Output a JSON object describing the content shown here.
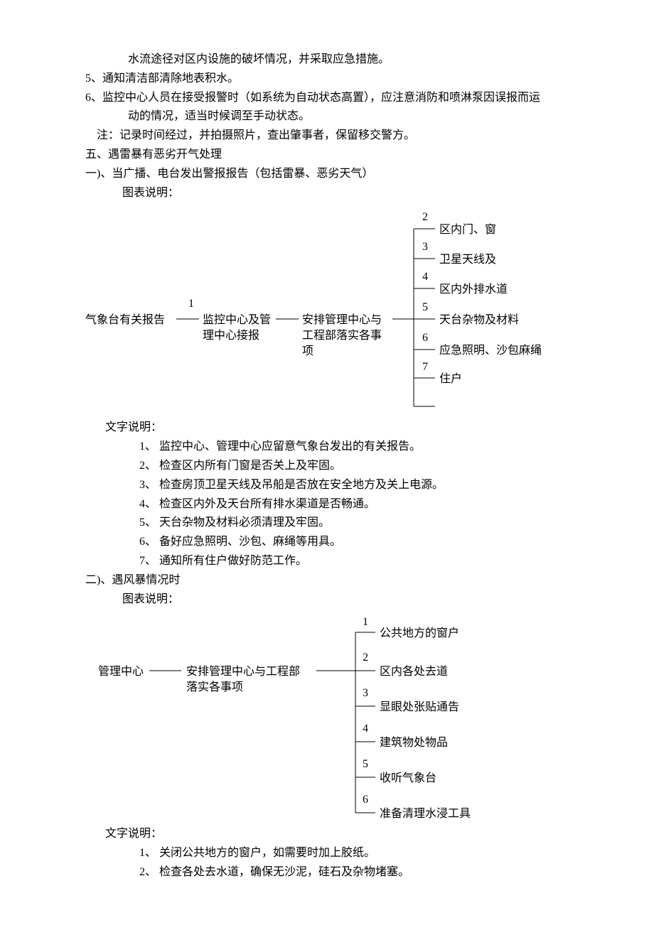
{
  "top": {
    "line0": "　　水流途径对区内设施的破坏情况，并采取应急措施。",
    "item5": "5、通知清洁部清除地表积水。",
    "item6a": "6、监控中心人员在接受报警时（如系统为自动状态高置），应注意消防和喷淋泵因误报而运",
    "item6b": "　　动的情况，适当时候调至手动状态。",
    "note": "　注：记录时间经过，并拍摄照片，查出肇事者，保留移交警方。"
  },
  "sec5": {
    "heading": "五、遇雷暴有恶劣开气处理",
    "sub1": "一)、当广播、电台发出警报报告（包括雷暴、恶劣天气）",
    "chartLabel": "图表说明：",
    "diagram": {
      "a": "气象台有关报告",
      "b1": "监控中心及管",
      "b2": "理中心接报",
      "c1": "安排管理中心与",
      "c2": "工程部落实各事",
      "c3": "项",
      "n2": "2",
      "t2": "区内门、窗",
      "n3": "3",
      "t3": "卫星天线及",
      "n4": "4",
      "t4": "区内外排水道",
      "n5": "5",
      "t5": "天台杂物及材料",
      "n6": "6",
      "t6": "应急照明、沙包麻绳",
      "n7": "7",
      "t7": "住户",
      "n1": "1"
    },
    "textLabel": "文字说明：",
    "t1": "1、 监控中心、管理中心应留意气象台发出的有关报告。",
    "t2": "2、 检查区内所有门窗是否关上及牢固。",
    "t3": "3、 检查房顶卫星天线及吊船是否放在安全地方及关上电源。",
    "t4": "4、 检查区内外及天台所有排水渠道是否畅通。",
    "t5": "5、 天台杂物及材料必须清理及牢固。",
    "t6": "6、 备好应急照明、沙包、麻绳等用具。",
    "t7": "7、 通知所有住户做好防范工作。"
  },
  "sec2b": {
    "sub2": "二)、遇风暴情况时",
    "chartLabel": "图表说明：",
    "diagram": {
      "a": "管理中心",
      "b1": "安排管理中心与工程部",
      "b2": "落实各事项",
      "n1": "1",
      "t1": "公共地方的窗户",
      "n2": "2",
      "t2": "区内各处去道",
      "n3": "3",
      "t3": "显眼处张贴通告",
      "n4": "4",
      "t4": "建筑物处物品",
      "n5": "5",
      "t5": "收听气象台",
      "n6": "6",
      "t6": "准备清理水浸工具"
    },
    "textLabel": "文字说明：",
    "t1": "1、 关闭公共地方的窗户，如需要时加上胶纸。",
    "t2": "2、 检查各处去水道，确保无沙泥，硅石及杂物堵塞。"
  }
}
